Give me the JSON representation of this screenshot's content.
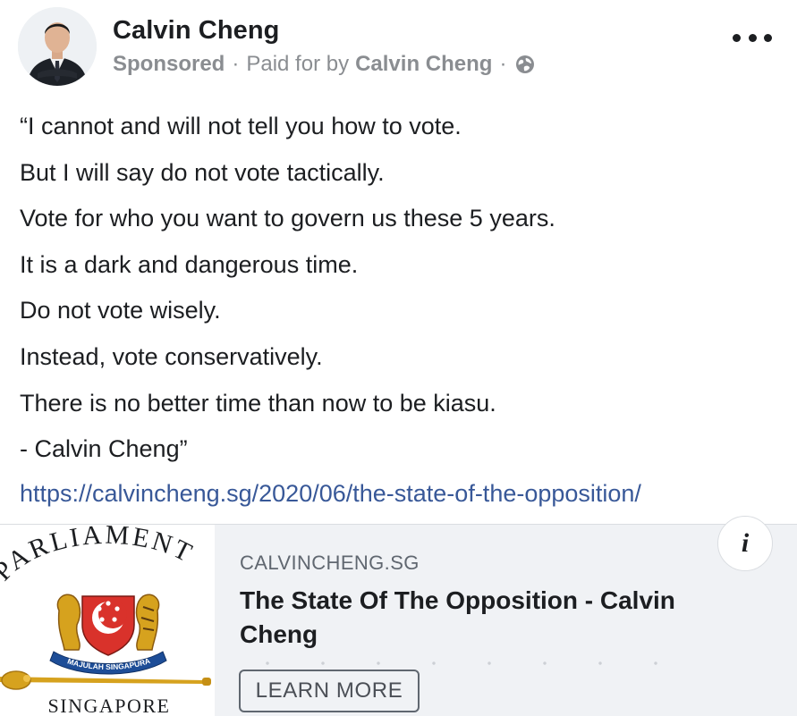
{
  "author": {
    "name": "Calvin Cheng",
    "avatar_icon": "profile-photo"
  },
  "meta": {
    "sponsored": "Sponsored",
    "separator": "·",
    "paid_for_prefix": "Paid for by",
    "paid_for_name": "Calvin Cheng",
    "audience_icon": "globe-icon"
  },
  "menu": {
    "more_icon": "more-dots-icon"
  },
  "post": {
    "lines": [
      "“I cannot and will not tell you how to vote.",
      "But I will say do not vote tactically.",
      "Vote for who you want to govern us these 5 years.",
      "It is a dark and dangerous time.",
      "Do not vote wisely.",
      "Instead, vote conservatively.",
      "There is no better time than now to be kiasu.",
      "- Calvin Cheng”"
    ],
    "link": "https://calvincheng.sg/2020/06/the-state-of-the-opposition/"
  },
  "link_card": {
    "thumbnail": {
      "arc_text": "PARLIAMENT",
      "ribbon_text": "MAJULAH SINGAPURA",
      "bottom_text": "SINGAPORE"
    },
    "domain": "CALVINCHENG.SG",
    "title": "The State Of The Opposition - Calvin Cheng",
    "cta_label": "LEARN MORE",
    "info_label": "i"
  },
  "colors": {
    "link": "#385898",
    "meta": "#8a8d91",
    "card_background": "#f0f2f5",
    "crest_red": "#d9322b",
    "mace_gold": "#d6a21e"
  }
}
